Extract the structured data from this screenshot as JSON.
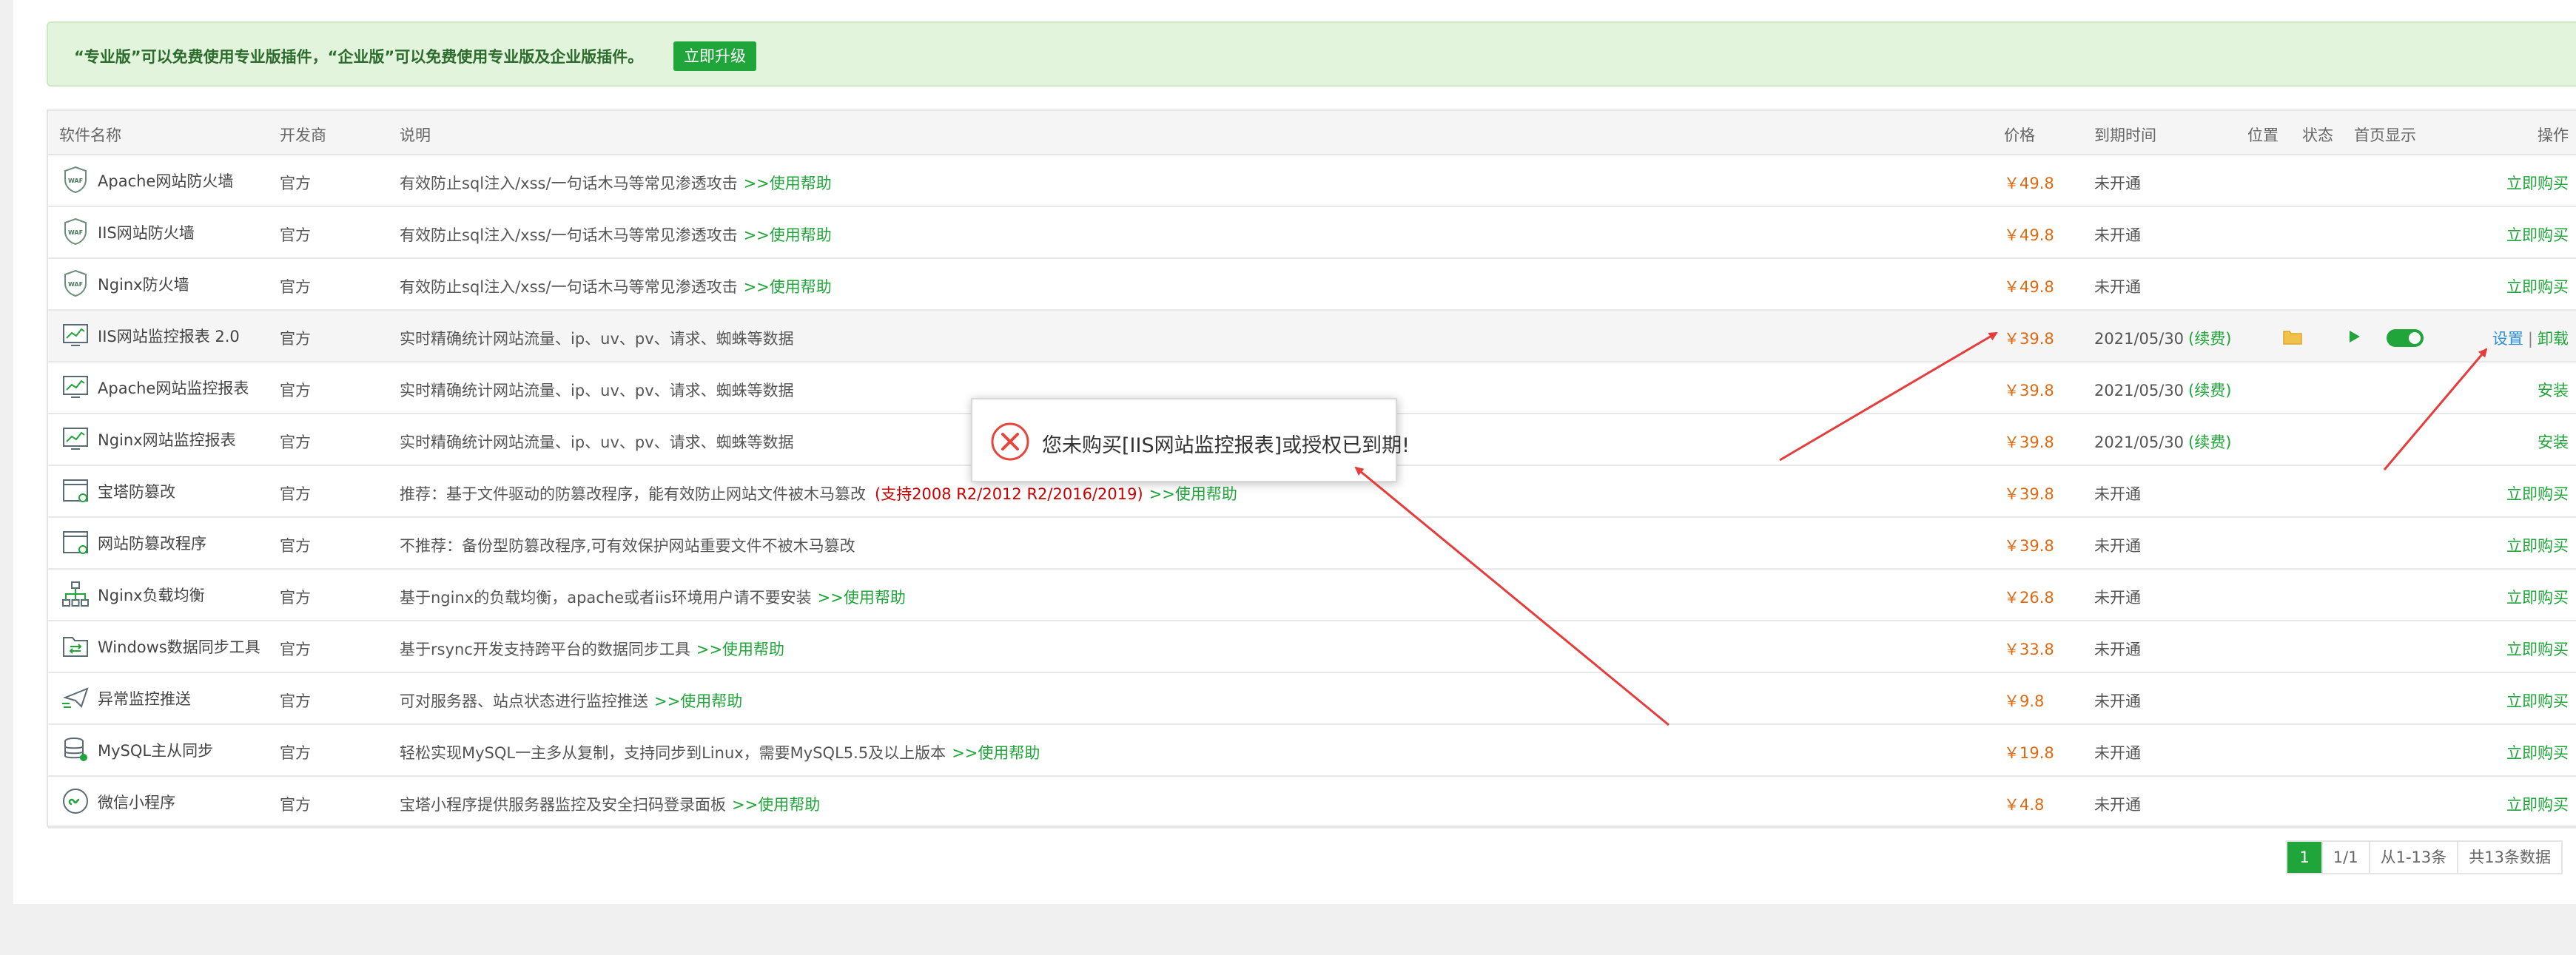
{
  "notice": {
    "text": "“专业版”可以免费使用专业版插件，“企业版”可以免费使用专业版及企业版插件。",
    "button": "立即升级"
  },
  "table": {
    "headers": {
      "name": "软件名称",
      "developer": "开发商",
      "description": "说明",
      "price": "价格",
      "expire": "到期时间",
      "location": "位置",
      "status": "状态",
      "homepage": "首页显示",
      "actions": "操作"
    },
    "rows": [
      {
        "icon": "waf-shield-icon",
        "name": "Apache网站防火墙",
        "developer": "官方",
        "desc": "有效防止sql注入/xss/一句话木马等常见渗透攻击",
        "note": "",
        "help": ">>使用帮助",
        "price": "￥49.8",
        "expire": "未开通",
        "renew": "",
        "action": "立即购买"
      },
      {
        "icon": "waf-shield-icon",
        "name": "IIS网站防火墙",
        "developer": "官方",
        "desc": "有效防止sql注入/xss/一句话木马等常见渗透攻击",
        "note": "",
        "help": ">>使用帮助",
        "price": "￥49.8",
        "expire": "未开通",
        "renew": "",
        "action": "立即购买"
      },
      {
        "icon": "waf-shield-icon",
        "name": "Nginx防火墙",
        "developer": "官方",
        "desc": "有效防止sql注入/xss/一句话木马等常见渗透攻击",
        "note": "",
        "help": ">>使用帮助",
        "price": "￥49.8",
        "expire": "未开通",
        "renew": "",
        "action": "立即购买"
      },
      {
        "icon": "monitor-chart-icon",
        "name": "IIS网站监控报表 2.0",
        "developer": "官方",
        "desc": "实时精确统计网站流量、ip、uv、pv、请求、蜘蛛等数据",
        "note": "",
        "help": "",
        "price": "￥39.8",
        "expire": "2021/05/30",
        "renew": "(续费)",
        "action": "",
        "setup": "设置",
        "uninstall": "卸载",
        "installed": true
      },
      {
        "icon": "monitor-chart-icon",
        "name": "Apache网站监控报表",
        "developer": "官方",
        "desc": "实时精确统计网站流量、ip、uv、pv、请求、蜘蛛等数据",
        "note": "",
        "help": "",
        "price": "￥39.8",
        "expire": "2021/05/30",
        "renew": "(续费)",
        "action": "安装"
      },
      {
        "icon": "monitor-chart-icon",
        "name": "Nginx网站监控报表",
        "developer": "官方",
        "desc": "实时精确统计网站流量、ip、uv、pv、请求、蜘蛛等数据",
        "note": "",
        "help": "",
        "price": "￥39.8",
        "expire": "2021/05/30",
        "renew": "(续费)",
        "action": "安装"
      },
      {
        "icon": "tamper-window-icon",
        "name": "宝塔防篡改",
        "developer": "官方",
        "desc": "推荐：基于文件驱动的防篡改程序，能有效防止网站文件被木马篡改",
        "note": "(支持2008 R2/2012 R2/2016/2019)",
        "help": ">>使用帮助",
        "price": "￥39.8",
        "expire": "未开通",
        "renew": "",
        "action": "立即购买"
      },
      {
        "icon": "tamper-window-icon",
        "name": "网站防篡改程序",
        "developer": "官方",
        "desc": "不推荐：备份型防篡改程序,可有效保护网站重要文件不被木马篡改",
        "note": "",
        "help": "",
        "price": "￥39.8",
        "expire": "未开通",
        "renew": "",
        "action": "立即购买"
      },
      {
        "icon": "load-balance-icon",
        "name": "Nginx负载均衡",
        "developer": "官方",
        "desc": "基于nginx的负载均衡，apache或者iis环境用户请不要安装",
        "note": "",
        "help": ">>使用帮助",
        "price": "￥26.8",
        "expire": "未开通",
        "renew": "",
        "action": "立即购买"
      },
      {
        "icon": "sync-folder-icon",
        "name": "Windows数据同步工具",
        "developer": "官方",
        "desc": "基于rsync开发支持跨平台的数据同步工具",
        "note": "",
        "help": ">>使用帮助",
        "price": "￥33.8",
        "expire": "未开通",
        "renew": "",
        "action": "立即购买"
      },
      {
        "icon": "push-send-icon",
        "name": "异常监控推送",
        "developer": "官方",
        "desc": "可对服务器、站点状态进行监控推送",
        "note": "",
        "help": ">>使用帮助",
        "price": "￥9.8",
        "expire": "未开通",
        "renew": "",
        "action": "立即购买"
      },
      {
        "icon": "database-icon",
        "name": "MySQL主从同步",
        "developer": "官方",
        "desc": "轻松实现MySQL一主多从复制，支持同步到Linux，需要MySQL5.5及以上版本",
        "note": "",
        "help": ">>使用帮助",
        "price": "￥19.8",
        "expire": "未开通",
        "renew": "",
        "action": "立即购买"
      },
      {
        "icon": "wechat-miniapp-icon",
        "name": "微信小程序",
        "developer": "官方",
        "desc": "宝塔小程序提供服务器监控及安全扫码登录面板",
        "note": "",
        "help": ">>使用帮助",
        "price": "￥4.8",
        "expire": "未开通",
        "renew": "",
        "action": "立即购买"
      }
    ]
  },
  "pagination": {
    "current": "1",
    "pages": "1/1",
    "range": "从1-13条",
    "total": "共13条数据"
  },
  "dialog": {
    "icon": "error-circle-icon",
    "message": "您未购买[IIS网站监控报表]或授权已到期!"
  },
  "colors": {
    "brand_green": "#20a53a",
    "price_orange": "#e06a11",
    "annotation_red": "#e63c3c"
  }
}
